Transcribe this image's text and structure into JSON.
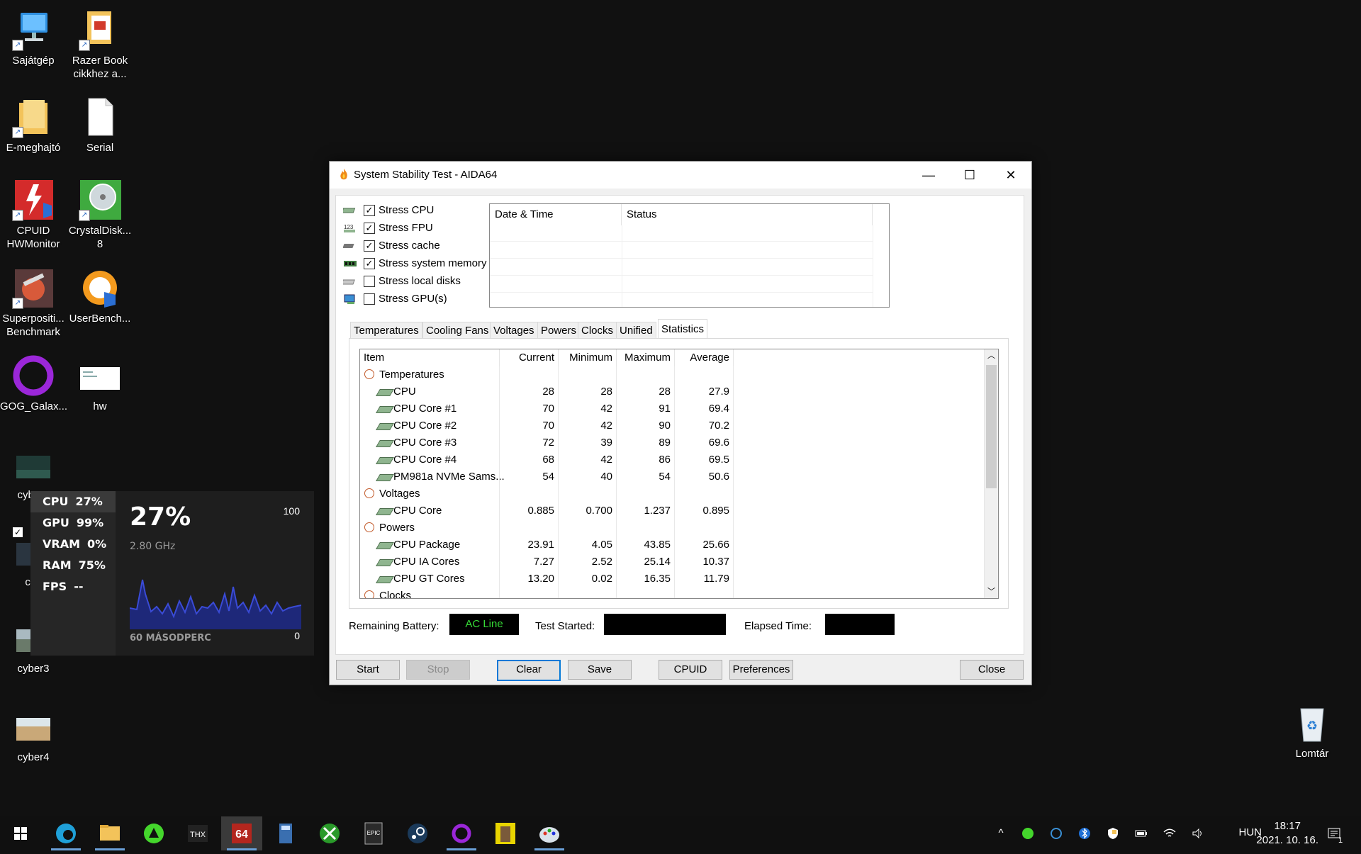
{
  "desktop": {
    "icons": [
      {
        "label": "Sajátgép"
      },
      {
        "label": "Razer Book cikkhez a..."
      },
      {
        "label": "E-meghajtó"
      },
      {
        "label": "Serial"
      },
      {
        "label": "CPUID HWMonitor"
      },
      {
        "label": "CrystalDisk... 8"
      },
      {
        "label": "Superpositi... Benchmark"
      },
      {
        "label": "UserBench..."
      },
      {
        "label": "GOG_Galax..."
      },
      {
        "label": "hw"
      },
      {
        "label": "cyber1"
      },
      {
        "label": "cyb"
      },
      {
        "label": "cyber3"
      },
      {
        "label": "cyber4"
      },
      {
        "label": "Lomtár"
      }
    ]
  },
  "perf_widget": {
    "rows": [
      {
        "name": "CPU",
        "value": "27%"
      },
      {
        "name": "GPU",
        "value": "99%"
      },
      {
        "name": "VRAM",
        "value": "0%"
      },
      {
        "name": "RAM",
        "value": "75%"
      },
      {
        "name": "FPS",
        "value": "--"
      }
    ],
    "big_value": "27%",
    "freq": "2.80 GHz",
    "max": "100",
    "min": "0",
    "period": "60 MÁSODPERC",
    "line_color": "#3a4bd6",
    "fill_color": "#1f2a8a"
  },
  "window": {
    "title": "System Stability Test - AIDA64",
    "stress_options": [
      {
        "label": "Stress CPU",
        "checked": true
      },
      {
        "label": "Stress FPU",
        "checked": true
      },
      {
        "label": "Stress cache",
        "checked": true
      },
      {
        "label": "Stress system memory",
        "checked": true
      },
      {
        "label": "Stress local disks",
        "checked": false
      },
      {
        "label": "Stress GPU(s)",
        "checked": false
      }
    ],
    "log_headers": {
      "date": "Date & Time",
      "status": "Status"
    },
    "tabs": [
      "Temperatures",
      "Cooling Fans",
      "Voltages",
      "Powers",
      "Clocks",
      "Unified",
      "Statistics"
    ],
    "active_tab": "Statistics",
    "stats_headers": {
      "item": "Item",
      "current": "Current",
      "minimum": "Minimum",
      "maximum": "Maximum",
      "average": "Average"
    },
    "stats_rows": [
      {
        "type": "section",
        "name": "Temperatures"
      },
      {
        "type": "item",
        "name": "CPU",
        "current": "28",
        "minimum": "28",
        "maximum": "28",
        "average": "27.9"
      },
      {
        "type": "item",
        "name": "CPU Core #1",
        "current": "70",
        "minimum": "42",
        "maximum": "91",
        "average": "69.4"
      },
      {
        "type": "item",
        "name": "CPU Core #2",
        "current": "70",
        "minimum": "42",
        "maximum": "90",
        "average": "70.2"
      },
      {
        "type": "item",
        "name": "CPU Core #3",
        "current": "72",
        "minimum": "39",
        "maximum": "89",
        "average": "69.6"
      },
      {
        "type": "item",
        "name": "CPU Core #4",
        "current": "68",
        "minimum": "42",
        "maximum": "86",
        "average": "69.5"
      },
      {
        "type": "item",
        "name": "PM981a NVMe Sams...",
        "current": "54",
        "minimum": "40",
        "maximum": "54",
        "average": "50.6"
      },
      {
        "type": "section",
        "name": "Voltages"
      },
      {
        "type": "item",
        "name": "CPU Core",
        "current": "0.885",
        "minimum": "0.700",
        "maximum": "1.237",
        "average": "0.895"
      },
      {
        "type": "section",
        "name": "Powers"
      },
      {
        "type": "item",
        "name": "CPU Package",
        "current": "23.91",
        "minimum": "4.05",
        "maximum": "43.85",
        "average": "25.66"
      },
      {
        "type": "item",
        "name": "CPU IA Cores",
        "current": "7.27",
        "minimum": "2.52",
        "maximum": "25.14",
        "average": "10.37"
      },
      {
        "type": "item",
        "name": "CPU GT Cores",
        "current": "13.20",
        "minimum": "0.02",
        "maximum": "16.35",
        "average": "11.79"
      },
      {
        "type": "section",
        "name": "Clocks"
      }
    ],
    "remaining_battery_label": "Remaining Battery:",
    "remaining_battery_value": "AC Line",
    "test_started_label": "Test Started:",
    "test_started_value": "",
    "elapsed_label": "Elapsed Time:",
    "elapsed_value": "",
    "buttons": {
      "start": "Start",
      "stop": "Stop",
      "clear": "Clear",
      "save": "Save",
      "cpuid": "CPUID",
      "preferences": "Preferences",
      "close": "Close"
    }
  },
  "taskbar": {
    "language": "HUN",
    "time": "18:17",
    "date": "2021. 10. 16.",
    "notification_count": "1",
    "aida_label": "64"
  }
}
